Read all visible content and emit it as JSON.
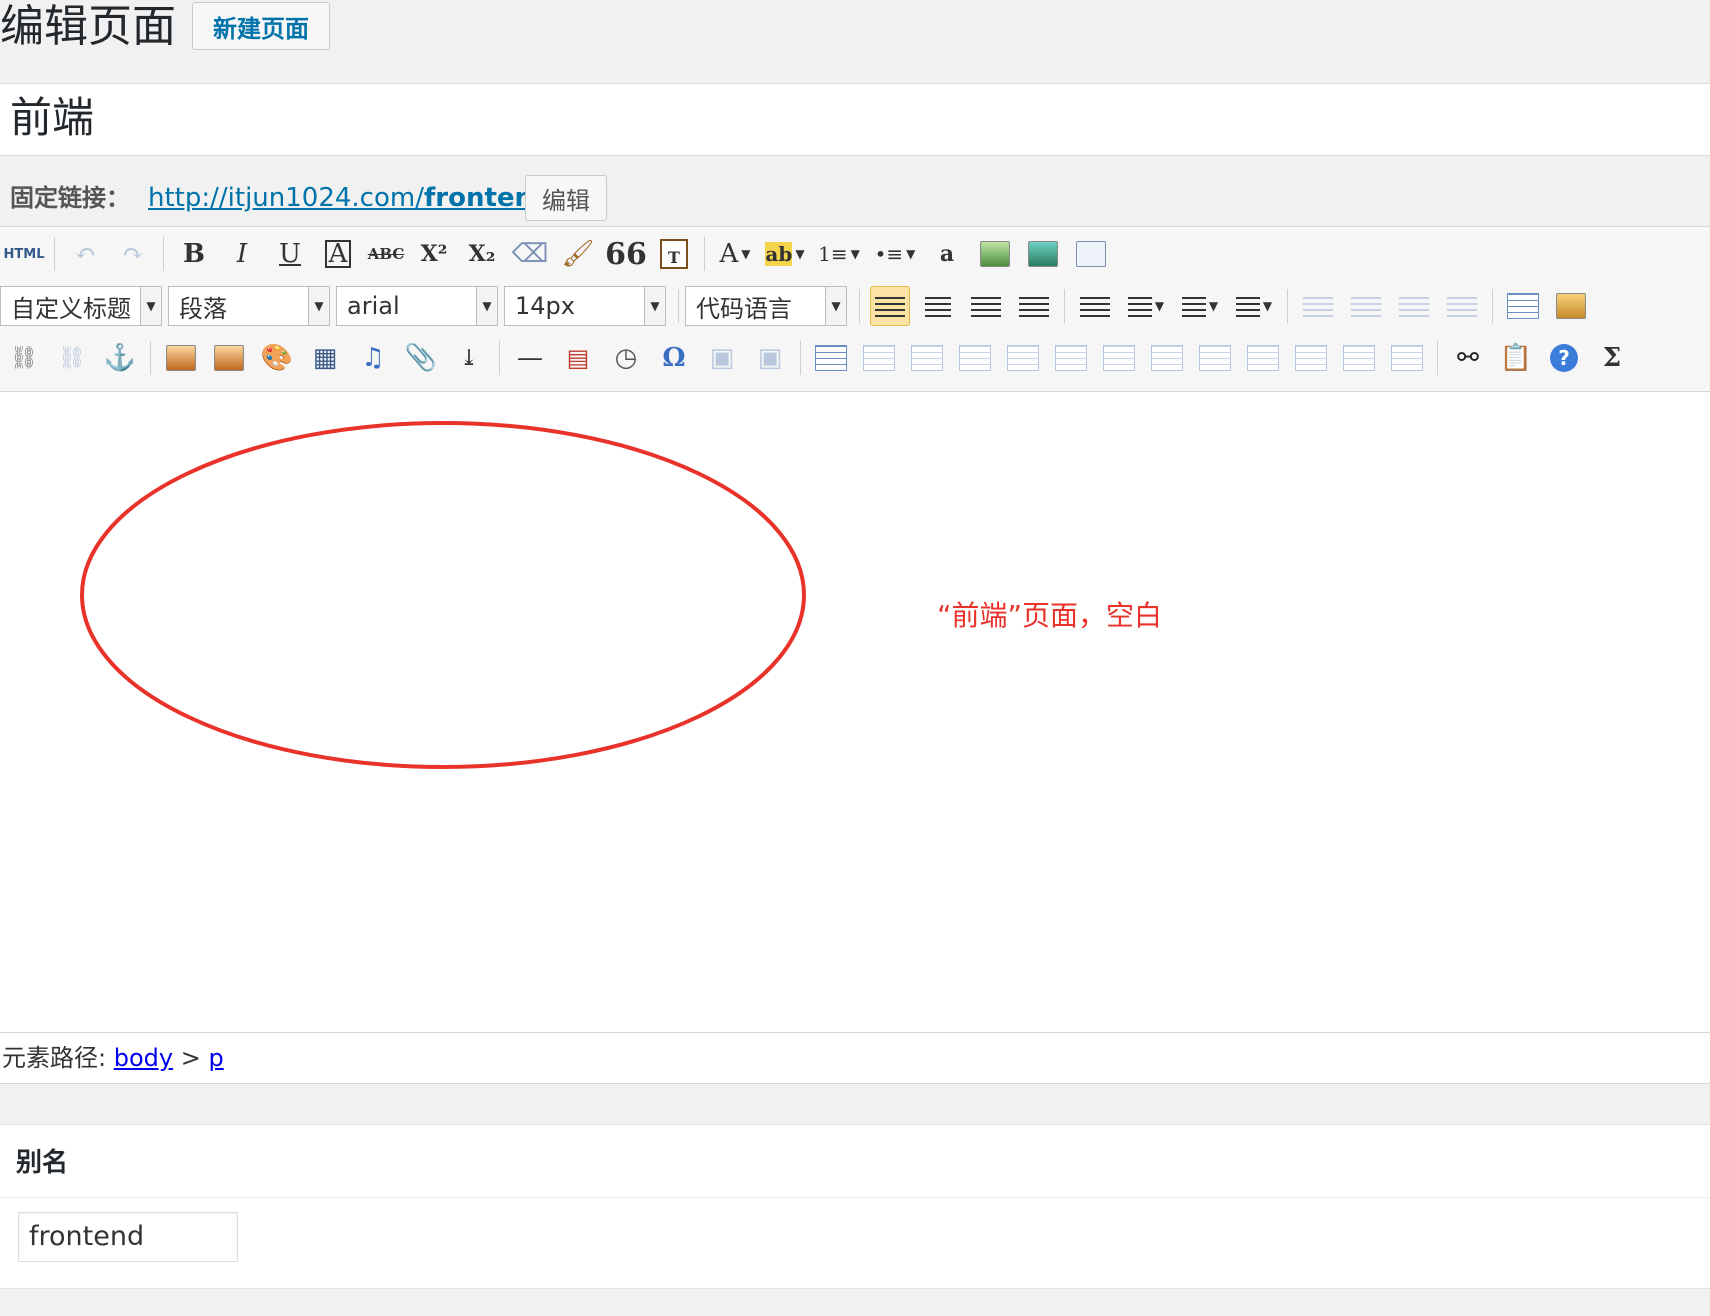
{
  "header": {
    "page_title": "编辑页面",
    "new_page_button": "新建页面"
  },
  "title_field": {
    "value": "前端"
  },
  "permalink": {
    "label": "固定链接：",
    "url_prefix": "http://itjun1024.com/",
    "url_slug": "frontend",
    "edit_button": "编辑"
  },
  "toolbar": {
    "row1": {
      "html": "HTML",
      "bold": "B",
      "italic": "I",
      "underline": "U",
      "font_border": "A",
      "strike": "ABC",
      "superscript": "X²",
      "subscript": "X₂",
      "blockquote": "66",
      "font_color": "A",
      "highlight": "ab",
      "ordered_list": "1≡",
      "unordered_list": "•≡",
      "a_icon": "a"
    },
    "row2": {
      "custom_heading": "自定义标题",
      "paragraph": "段落",
      "font_family": "arial",
      "font_size": "14px",
      "code_language": "代码语言"
    },
    "row3": {
      "special_char": "Ω",
      "formula": "Σ"
    }
  },
  "editor": {
    "annotation": "“前端”页面，空白",
    "annotation_color": "#e8322a"
  },
  "element_path": {
    "label": "元素路径: ",
    "path": [
      "body",
      "p"
    ],
    "separator": " > "
  },
  "slug": {
    "title": "别名",
    "value": "frontend"
  }
}
